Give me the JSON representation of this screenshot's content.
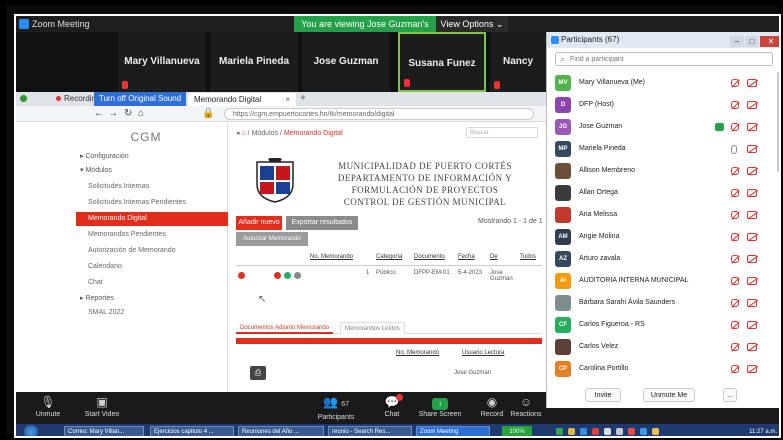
{
  "zoom": {
    "title": "Zoom Meeting",
    "banner": "You are viewing Jose Guzman's screen",
    "view_options": "View Options ⌄"
  },
  "video_strip": [
    {
      "name": "Mary Villanueva"
    },
    {
      "name": "Mariela Pineda"
    },
    {
      "name": "Jose Guzman"
    },
    {
      "name": "Susana Funez",
      "active": true
    },
    {
      "name": "Nancy Clavas"
    }
  ],
  "browser": {
    "recording_label": "Recording",
    "orig_sound": "Turn off Original Sound",
    "tab_title": "Memorando Digital",
    "url": "https://cgm.empuertocortes.hn/tk/memorando/digital"
  },
  "app": {
    "brand": "CGM",
    "sidebar": [
      {
        "label": "Configuración",
        "type": "head"
      },
      {
        "label": "Módulos",
        "type": "head"
      },
      {
        "label": "Solicitudes Internas",
        "type": "item"
      },
      {
        "label": "Solicitudes Internas Pendientes",
        "type": "item"
      },
      {
        "label": "Memorando Digital",
        "type": "item",
        "active": true
      },
      {
        "label": "Memorandos Pendientes",
        "type": "item"
      },
      {
        "label": "Autorización de Memorando",
        "type": "item"
      },
      {
        "label": "Calendario",
        "type": "item"
      },
      {
        "label": "Chat",
        "type": "item"
      },
      {
        "label": "Reportes",
        "type": "head"
      },
      {
        "label": "SMAL 2022",
        "type": "item"
      }
    ],
    "breadcrumb": {
      "home": "⌂",
      "sep": "/",
      "modules": "Módulos",
      "current": "Memorando Digital"
    },
    "search_placeholder": "Buscar",
    "header": [
      "MUNICIPALIDAD DE PUERTO CORTÉS",
      "DEPARTAMENTO DE INFORMACIÓN Y FORMULACIÓN DE PROYECTOS",
      "CONTROL DE GESTIÓN MUNICIPAL"
    ],
    "btn_new": "Añadir nuevo",
    "btn_print": "Exportar resultados",
    "btn_auth": "Autorizar Memorando",
    "showing": "Mostrando 1 - 1 de 1",
    "columns": [
      "No. Memorando",
      "Categoría",
      "Documento",
      "Fecha",
      "De",
      "Todos"
    ],
    "row": {
      "num": "1",
      "cat": "Público",
      "doc": "DFPP-EM-01",
      "date": "5-4-2023",
      "from": "Jose Guzman"
    },
    "subtabs": [
      "Documentos Adjunto Memorando",
      "Memorandos Leídos"
    ],
    "sub_columns": [
      "No. Memorando",
      "Usuario Lectura"
    ],
    "sub_row": {
      "user": "Jose Guzman"
    }
  },
  "participants": {
    "title": "Participants (67)",
    "search_placeholder": "Find a participant",
    "list": [
      {
        "initials": "MV",
        "color": "#4fb54a",
        "name": "Mary Villanueva (Me)"
      },
      {
        "initials": "D",
        "color": "#8e44ad",
        "name": "DFP (Host)"
      },
      {
        "initials": "JG",
        "color": "#9b59b6",
        "name": "Jose Guzman",
        "sharing": true
      },
      {
        "initials": "MP",
        "color": "#34495e",
        "name": "Mariela Pineda",
        "mic_on": true
      },
      {
        "initials": "",
        "color": "#6b4f3a",
        "name": "Allison Membreno"
      },
      {
        "initials": "",
        "color": "#3b3b3b",
        "name": "Allan Ortega"
      },
      {
        "initials": "",
        "color": "#c0392b",
        "name": "Ana Melissa"
      },
      {
        "initials": "AM",
        "color": "#2c3e50",
        "name": "Angie Molina"
      },
      {
        "initials": "AZ",
        "color": "#34495e",
        "name": "Arturo zavala"
      },
      {
        "initials": "AI",
        "color": "#f39c12",
        "name": "AUDITORIA INTERNA MUNICIPAL"
      },
      {
        "initials": "",
        "color": "#7f8c8d",
        "name": "Bárbara Sarahi Ávila Saunders"
      },
      {
        "initials": "CF",
        "color": "#27ae60",
        "name": "Carlos Figueroa - RS"
      },
      {
        "initials": "",
        "color": "#5d4037",
        "name": "Carlos Velez"
      },
      {
        "initials": "CP",
        "color": "#e67e22",
        "name": "Carolina Portillo"
      }
    ],
    "btn_invite": "Invite",
    "btn_unmute": "Unmute Me",
    "btn_more": "..."
  },
  "controls": {
    "unmute": "Unmute",
    "start_video": "Start Video",
    "participants": "Participants",
    "participants_count": "67",
    "chat": "Chat",
    "share": "Share Screen",
    "record": "Record",
    "reactions": "Reactions"
  },
  "taskbar": {
    "items": [
      "Correo: Mary Villan...",
      "Ejercicios capitulo 4 ...",
      "Reuniones del Año ...",
      "reunio - Search Res...",
      "Zoom Meeting"
    ],
    "percent": "100%",
    "clock": "11:27 a.m."
  }
}
